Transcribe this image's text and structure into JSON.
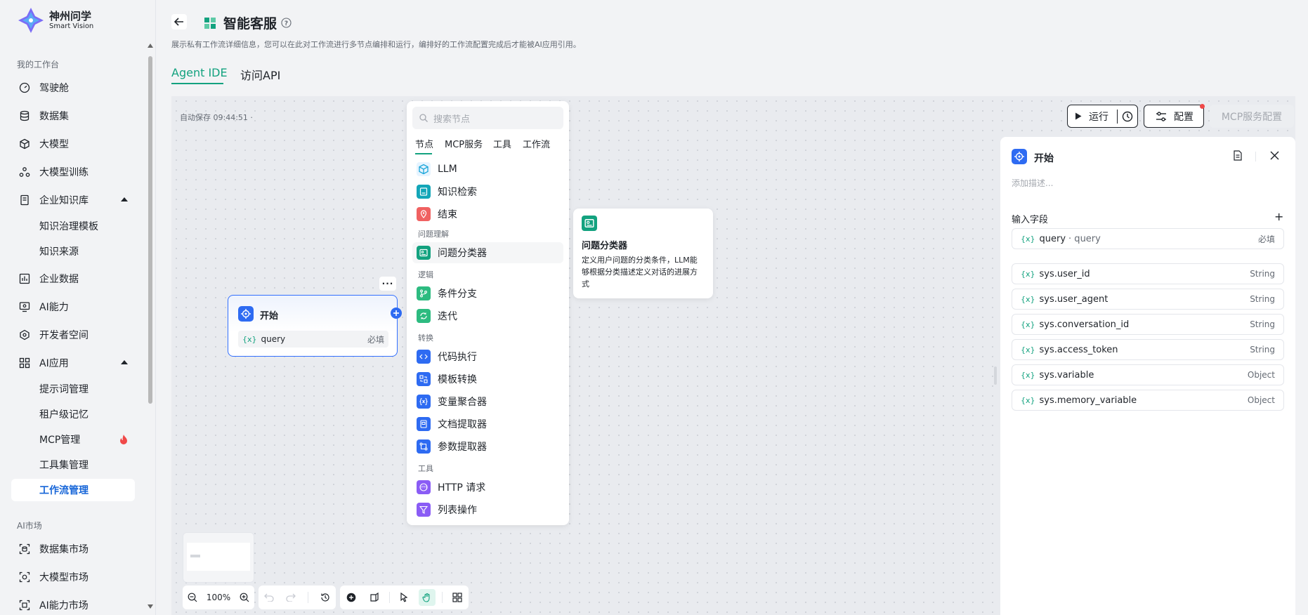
{
  "brand": {
    "name_cn": "神州问学",
    "name_en": "Smart Vision"
  },
  "sidebar": {
    "section_workspace": "我的工作台",
    "items": [
      {
        "label": "驾驶舱"
      },
      {
        "label": "数据集"
      },
      {
        "label": "大模型"
      },
      {
        "label": "大模型训练"
      },
      {
        "label": "企业知识库"
      },
      {
        "label": "知识治理模板"
      },
      {
        "label": "知识来源"
      },
      {
        "label": "企业数据"
      },
      {
        "label": "AI能力"
      },
      {
        "label": "开发者空间"
      },
      {
        "label": "AI应用"
      },
      {
        "label": "提示词管理"
      },
      {
        "label": "租户级记忆"
      },
      {
        "label": "MCP管理"
      },
      {
        "label": "工具集管理"
      },
      {
        "label": "工作流管理"
      }
    ],
    "section_market": "AI市场",
    "market_items": [
      {
        "label": "数据集市场"
      },
      {
        "label": "大模型市场"
      },
      {
        "label": "AI能力市场"
      }
    ]
  },
  "header": {
    "title": "智能客服",
    "description": "展示私有工作流详细信息，您可以在此对工作流进行多节点编排和运行，编排好的工作流配置完成后才能被AI应用引用。",
    "tabs": [
      {
        "label": "Agent IDE"
      },
      {
        "label": "访问API"
      }
    ]
  },
  "canvas": {
    "autosave": "自动保存 09:44:51 ·",
    "run_label": "运行",
    "config_label": "配置",
    "mcp_config_label": "MCP服务配置",
    "zoom": "100%"
  },
  "node_panel": {
    "search_placeholder": "搜索节点",
    "tabs": [
      {
        "label": "节点"
      },
      {
        "label": "MCP服务"
      },
      {
        "label": "工具"
      },
      {
        "label": "工作流"
      }
    ],
    "items": {
      "llm": "LLM",
      "knowledge": "知识检索",
      "end": "结束",
      "cat_understanding": "问题理解",
      "classifier": "问题分类器",
      "cat_logic": "逻辑",
      "branch": "条件分支",
      "iteration": "迭代",
      "cat_transform": "转换",
      "code": "代码执行",
      "template": "模板转换",
      "aggregator": "变量聚合器",
      "doc_extract": "文档提取器",
      "param_extract": "参数提取器",
      "cat_tools": "工具",
      "http": "HTTP 请求",
      "list_op": "列表操作"
    }
  },
  "tooltip": {
    "title": "问题分类器",
    "description": "定义用户问题的分类条件，LLM能够根据分类描述定义对话的进展方式"
  },
  "start_node": {
    "title": "开始",
    "field_var": "{x}",
    "field_name": "query",
    "field_required": "必填"
  },
  "right_panel": {
    "title": "开始",
    "description_placeholder": "添加描述...",
    "section_inputs": "输入字段",
    "input_field": {
      "var": "{x}",
      "name": "query",
      "alias": "· query",
      "required": "必填"
    },
    "sys_fields": [
      {
        "var": "{x}",
        "name": "sys.user_id",
        "type": "String"
      },
      {
        "var": "{x}",
        "name": "sys.user_agent",
        "type": "String"
      },
      {
        "var": "{x}",
        "name": "sys.conversation_id",
        "type": "String"
      },
      {
        "var": "{x}",
        "name": "sys.access_token",
        "type": "String"
      },
      {
        "var": "{x}",
        "name": "sys.variable",
        "type": "Object"
      },
      {
        "var": "{x}",
        "name": "sys.memory_variable",
        "type": "Object"
      }
    ]
  },
  "colors": {
    "accent": "#13a27f",
    "primary_blue": "#2e6bf2",
    "active_nav": "#1665d8",
    "hot": "#f04848"
  }
}
